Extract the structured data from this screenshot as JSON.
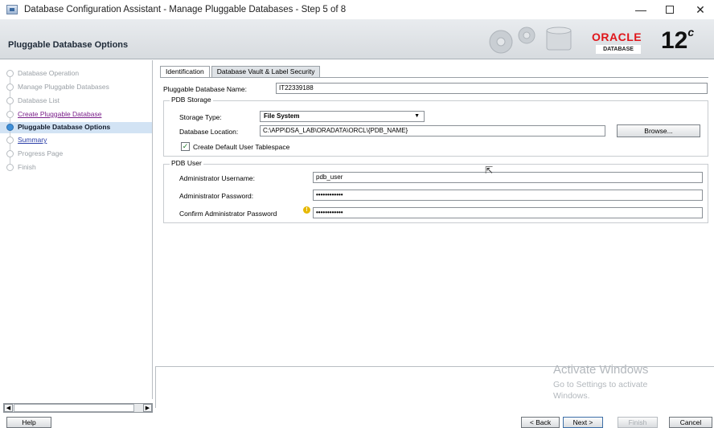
{
  "window": {
    "title": "Database Configuration Assistant - Manage Pluggable Databases - Step 5 of 8",
    "minimize": "—",
    "close": "✕"
  },
  "header": {
    "title": "Pluggable Database Options",
    "brand": "ORACLE",
    "brand_sub": "DATABASE",
    "version": "12",
    "version_suffix": "c",
    "brand_color": "#e0161b"
  },
  "steps": [
    {
      "label": "Database Operation",
      "state": "disabled"
    },
    {
      "label": "Manage Pluggable Databases",
      "state": "disabled"
    },
    {
      "label": "Database List",
      "state": "disabled"
    },
    {
      "label": "Create Pluggable Database",
      "state": "visited"
    },
    {
      "label": "Pluggable Database Options",
      "state": "current"
    },
    {
      "label": "Summary",
      "state": "link"
    },
    {
      "label": "Progress Page",
      "state": "disabled"
    },
    {
      "label": "Finish",
      "state": "disabled"
    }
  ],
  "tabs": {
    "identification": "Identification",
    "vault": "Database Vault & Label Security"
  },
  "form": {
    "pdb_name_label": "Pluggable Database Name:",
    "pdb_name_value": "IT22339188",
    "storage_group": "PDB Storage",
    "storage_type_label": "Storage Type:",
    "storage_type_value": "File System",
    "db_location_label": "Database Location:",
    "db_location_value": "C:\\APP\\DSA_LAB\\ORADATA\\ORCL\\{PDB_NAME}",
    "browse": "Browse...",
    "default_tablespace_label": "Create Default User Tablespace",
    "default_tablespace_checked": "✓",
    "user_group": "PDB User",
    "admin_user_label": "Administrator Username:",
    "admin_user_value": "pdb_user",
    "admin_pwd_label": "Administrator Password:",
    "admin_pwd_value": "••••••••••••",
    "confirm_pwd_label": "Confirm Administrator Password",
    "confirm_pwd_value": "••••••••••••"
  },
  "watermark": {
    "line1": "Activate Windows",
    "line2": "Go to Settings to activate",
    "line3": "Windows."
  },
  "buttons": {
    "help": "Help",
    "back": "< Back",
    "next": "Next >",
    "finish": "Finish",
    "cancel": "Cancel"
  }
}
